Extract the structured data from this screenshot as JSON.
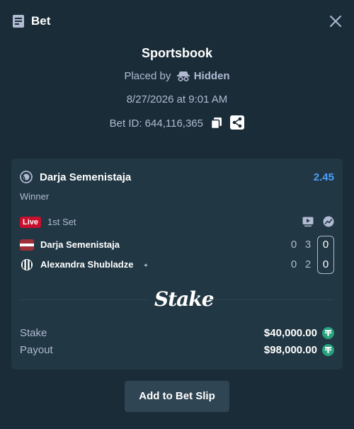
{
  "header": {
    "title": "Bet",
    "icon": "bet-slip-icon",
    "close_icon": "close-icon"
  },
  "summary": {
    "source": "Sportsbook",
    "placed_by_label": "Placed by",
    "placed_by_user": "Hidden",
    "datetime": "8/27/2026 at 9:01 AM",
    "bet_id": "Bet ID: 644,116,365"
  },
  "selection": {
    "sport_icon": "tennis-ball-icon",
    "name": "Darja Semenistaja",
    "odds": "2.45",
    "market": "Winner",
    "live_badge": "Live",
    "set_label": "1st Set"
  },
  "players": [
    {
      "name": "Darja Semenistaja",
      "flag": "latvia",
      "set1": "0",
      "set2": "3",
      "current": "0",
      "serving": false
    },
    {
      "name": "Alexandra Shubladze",
      "flag": "striped",
      "set1": "0",
      "set2": "2",
      "current": "0",
      "serving": true
    }
  ],
  "serve_indicator": "◂",
  "logo": "Stake",
  "totals": {
    "stake_label": "Stake",
    "stake_value": "$40,000.00",
    "payout_label": "Payout",
    "payout_value": "$98,000.00",
    "currency_icon": "tether-usdt-icon"
  },
  "actions": {
    "add_to_slip": "Add to Bet Slip"
  },
  "colors": {
    "background": "#1a2c38",
    "card": "#213743",
    "odds": "#4d9fff",
    "live": "#c8102e",
    "button": "#2f4553",
    "coin": "#26a17b"
  }
}
